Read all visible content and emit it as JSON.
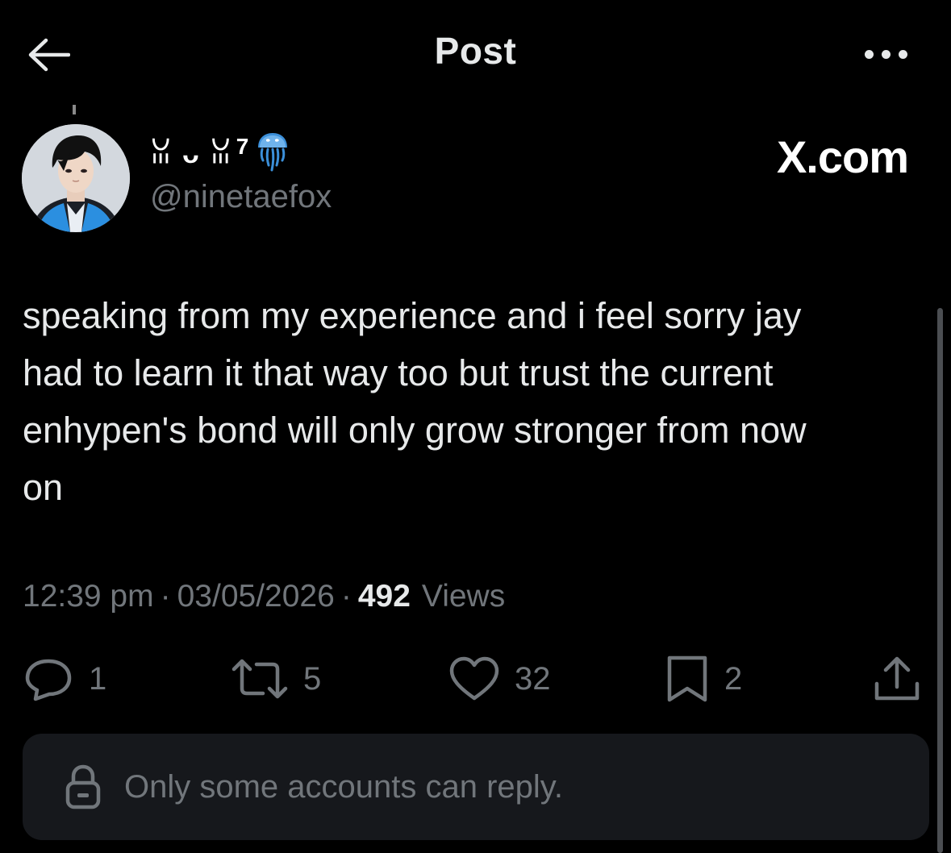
{
  "header": {
    "title": "Post",
    "back_icon": "arrow-left-icon",
    "more_icon": "more-horizontal-icon"
  },
  "author": {
    "display_name": "ꈍ ᴗ ꈍ",
    "name_suffix": "7",
    "emoji": "jellyfish-icon",
    "handle": "@ninetaefox"
  },
  "watermark": "X.com",
  "post": {
    "text": "speaking from my experience and i feel sorry jay\nhad to learn it that way too but trust the current\nenhypen's bond will only grow stronger from now\non"
  },
  "meta": {
    "time": "12:39 pm",
    "separator": "·",
    "date": "03/05/2026",
    "views_count": "492",
    "views_label": "Views"
  },
  "actions": {
    "replies": "1",
    "reposts": "5",
    "likes": "32",
    "bookmarks": "2"
  },
  "reply_restriction": {
    "text": "Only some accounts can reply."
  },
  "colors": {
    "background": "#000000",
    "text_primary": "#e7e9ea",
    "text_secondary": "#71767b",
    "banner_bg": "#16181c",
    "jellyfish": "#3b8fd9"
  }
}
